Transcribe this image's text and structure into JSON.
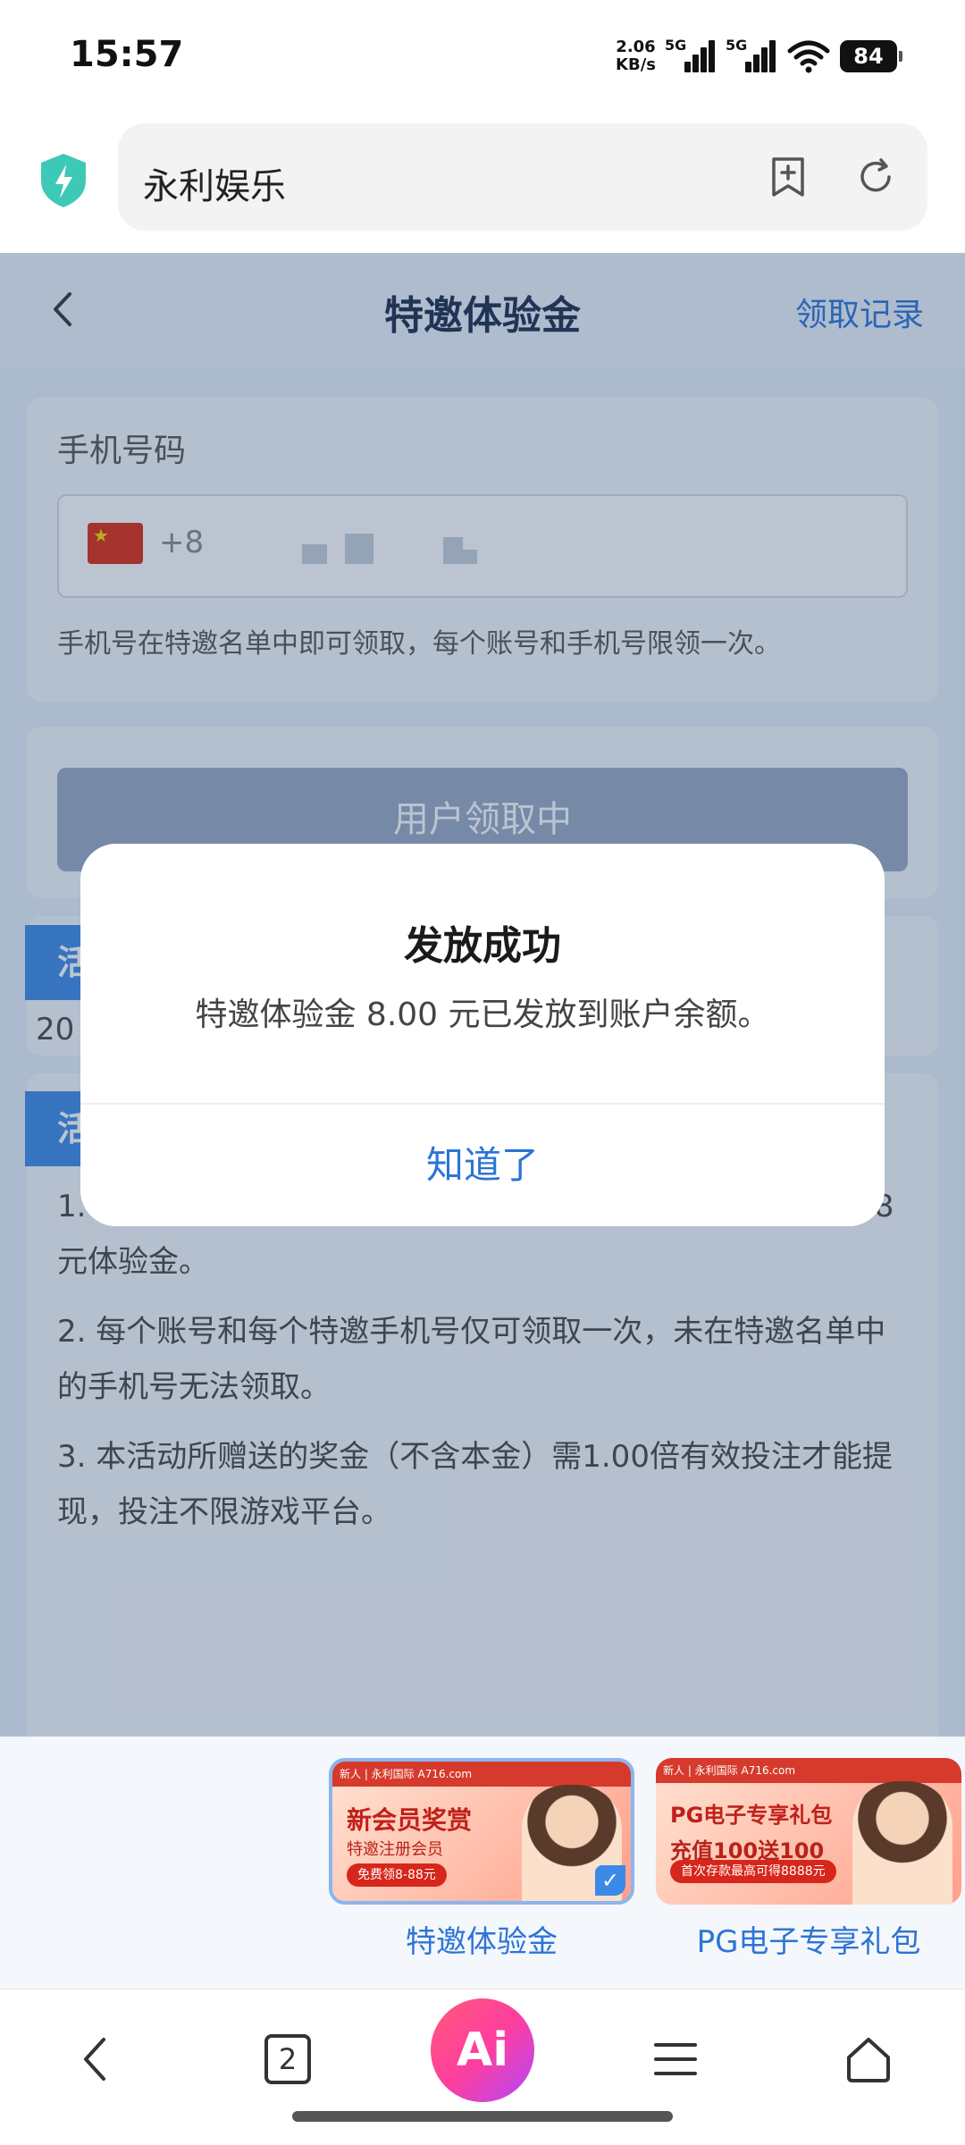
{
  "status_bar": {
    "time": "15:57",
    "net_speed_value": "2.06",
    "net_speed_unit": "KB/s",
    "signal1_label": "5G",
    "signal2_label": "5G",
    "battery": "84"
  },
  "browser": {
    "url_text": "永利娱乐"
  },
  "page": {
    "title": "特邀体验金",
    "records_link": "领取记录",
    "phone_label": "手机号码",
    "phone_prefix": "+8",
    "phone_hint": "手机号在特邀名单中即可领取，每个账号和手机号限领一次。",
    "claim_button": "用户领取中",
    "section_tag_1": "活",
    "partial_text": "20",
    "section_tag_2": "活动说明",
    "desc_items": [
      "1. 输入后台登记的特邀手机号，名单匹配后系统立即发放8-88元体验金。",
      "2. 每个账号和每个特邀手机号仅可领取一次，未在特邀名单中的手机号无法领取。",
      "3. 本活动所赠送的奖金（不含本金）需1.00倍有效投注才能提现，投注不限游戏平台。"
    ]
  },
  "dialog": {
    "title": "发放成功",
    "message": "特邀体验金 8.00 元已发放到账户余额。",
    "ok_button": "知道了"
  },
  "tabs": {
    "items": [
      {
        "label": "特邀体验金",
        "selected": true,
        "label_color": "#2d74d6",
        "thumb_top": "新人 | 永利国际 A716.com",
        "thumb_head": "新会员奖赏",
        "thumb_sub": "特邀注册会员",
        "thumb_pill": "免费领8-88元"
      },
      {
        "label": "PG电子专享礼包",
        "selected": false,
        "label_color": "#2d74d6",
        "thumb_top": "新人 | 永利国际 A716.com",
        "thumb_head": "PG电子专享礼包",
        "thumb_sub": "充值100送100",
        "thumb_pill": "首次存款最高可得8888元"
      }
    ]
  },
  "bottom_nav": {
    "tab_count": "2",
    "ai_label": "Ai"
  },
  "colors": {
    "accent": "#2d74d6",
    "section_tag": "#3b8ae8",
    "dialog_ok": "#2b74d3"
  }
}
